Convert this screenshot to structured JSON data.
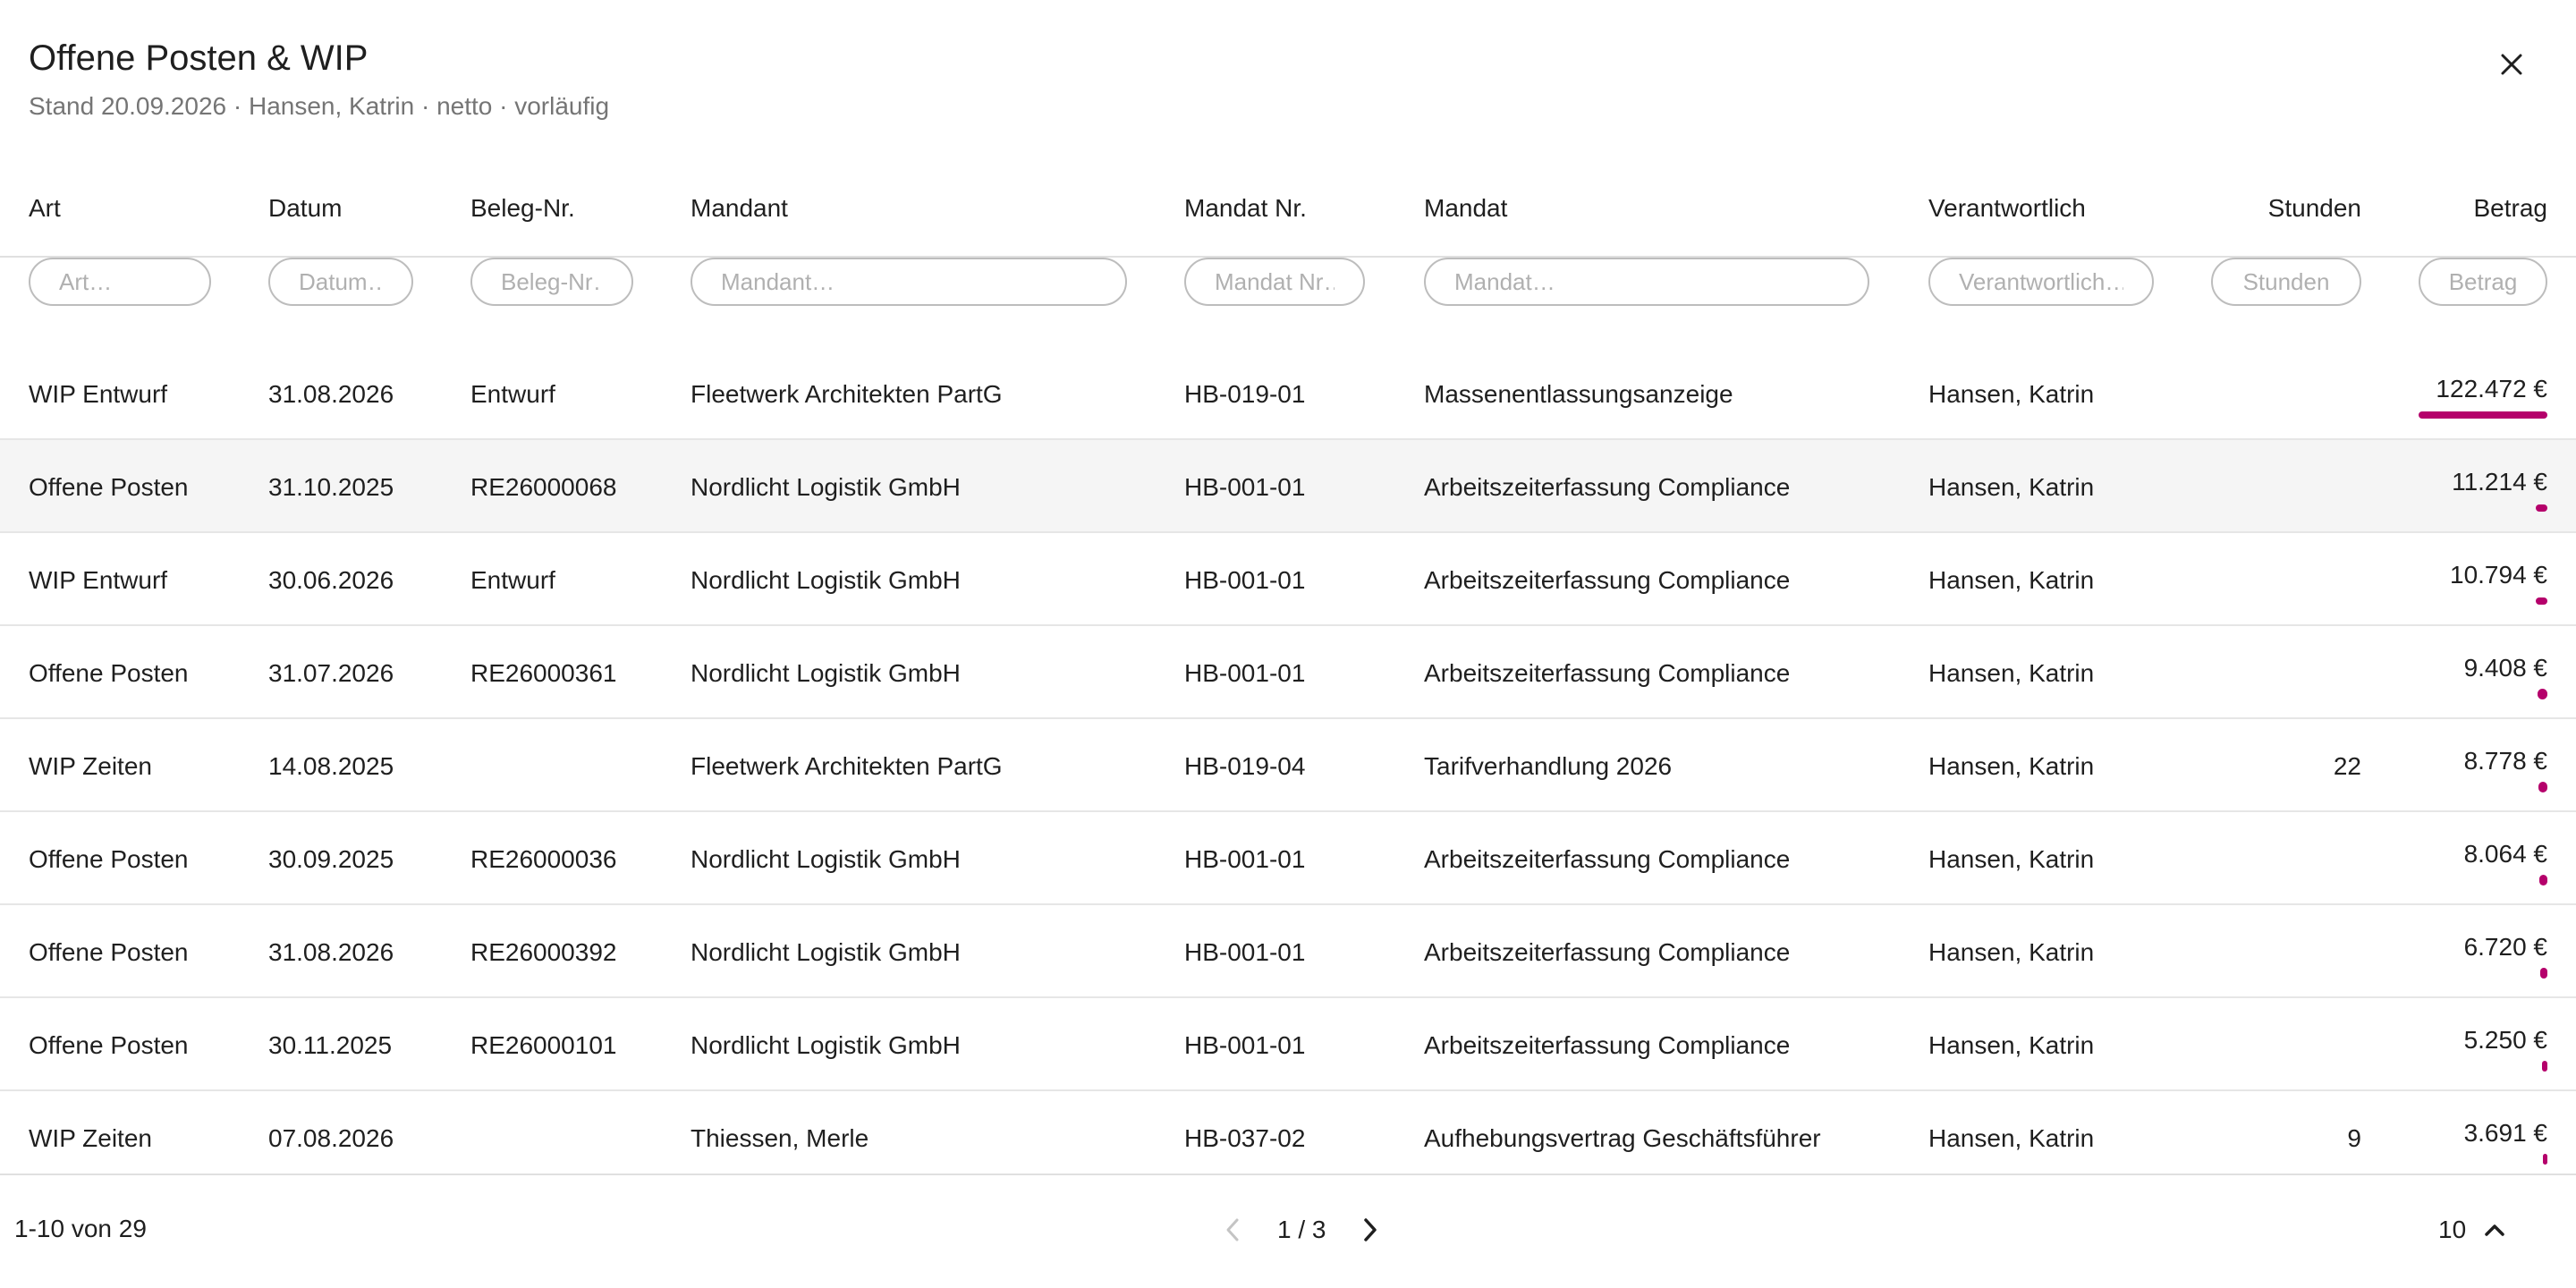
{
  "header": {
    "title": "Offene Posten & WIP",
    "subtitle": "Stand 20.09.2026 · Hansen, Katrin · netto · vorläufig"
  },
  "columns": {
    "art": "Art",
    "datum": "Datum",
    "beleg": "Beleg-Nr.",
    "mandant": "Mandant",
    "mandat_nr": "Mandat Nr.",
    "mandat": "Mandat",
    "verantwortlich": "Verantwortlich",
    "stunden": "Stunden",
    "betrag": "Betrag"
  },
  "filters": {
    "art": "Art…",
    "datum": "Datum…",
    "beleg": "Beleg-Nr…",
    "mandant": "Mandant…",
    "mandat_nr": "Mandat Nr…",
    "mandat": "Mandat…",
    "verantwortlich": "Verantwortlich…",
    "stunden": "Stunden",
    "betrag": "Betrag"
  },
  "accent_color": "#b5006b",
  "max_amount": 122472,
  "rows": [
    {
      "art": "WIP Entwurf",
      "datum": "31.08.2026",
      "beleg": "Entwurf",
      "mandant": "Fleetwerk Architekten PartG",
      "mandat_nr": "HB-019-01",
      "mandat": "Massenentlassungsanzeige",
      "verantwortlich": "Hansen, Katrin",
      "stunden": "",
      "betrag": "122.472 €",
      "amount": 122472
    },
    {
      "art": "Offene Posten",
      "datum": "31.10.2025",
      "beleg": "RE26000068",
      "mandant": "Nordlicht Logistik GmbH",
      "mandat_nr": "HB-001-01",
      "mandat": "Arbeitszeiterfassung Compliance",
      "verantwortlich": "Hansen, Katrin",
      "stunden": "",
      "betrag": "11.214 €",
      "amount": 11214
    },
    {
      "art": "WIP Entwurf",
      "datum": "30.06.2026",
      "beleg": "Entwurf",
      "mandant": "Nordlicht Logistik GmbH",
      "mandat_nr": "HB-001-01",
      "mandat": "Arbeitszeiterfassung Compliance",
      "verantwortlich": "Hansen, Katrin",
      "stunden": "",
      "betrag": "10.794 €",
      "amount": 10794
    },
    {
      "art": "Offene Posten",
      "datum": "31.07.2026",
      "beleg": "RE26000361",
      "mandant": "Nordlicht Logistik GmbH",
      "mandat_nr": "HB-001-01",
      "mandat": "Arbeitszeiterfassung Compliance",
      "verantwortlich": "Hansen, Katrin",
      "stunden": "",
      "betrag": "9.408 €",
      "amount": 9408
    },
    {
      "art": "WIP Zeiten",
      "datum": "14.08.2025",
      "beleg": "",
      "mandant": "Fleetwerk Architekten PartG",
      "mandat_nr": "HB-019-04",
      "mandat": "Tarifverhandlung 2026",
      "verantwortlich": "Hansen, Katrin",
      "stunden": "22",
      "betrag": "8.778 €",
      "amount": 8778
    },
    {
      "art": "Offene Posten",
      "datum": "30.09.2025",
      "beleg": "RE26000036",
      "mandant": "Nordlicht Logistik GmbH",
      "mandat_nr": "HB-001-01",
      "mandat": "Arbeitszeiterfassung Compliance",
      "verantwortlich": "Hansen, Katrin",
      "stunden": "",
      "betrag": "8.064 €",
      "amount": 8064
    },
    {
      "art": "Offene Posten",
      "datum": "31.08.2026",
      "beleg": "RE26000392",
      "mandant": "Nordlicht Logistik GmbH",
      "mandat_nr": "HB-001-01",
      "mandat": "Arbeitszeiterfassung Compliance",
      "verantwortlich": "Hansen, Katrin",
      "stunden": "",
      "betrag": "6.720 €",
      "amount": 6720
    },
    {
      "art": "Offene Posten",
      "datum": "30.11.2025",
      "beleg": "RE26000101",
      "mandant": "Nordlicht Logistik GmbH",
      "mandat_nr": "HB-001-01",
      "mandat": "Arbeitszeiterfassung Compliance",
      "verantwortlich": "Hansen, Katrin",
      "stunden": "",
      "betrag": "5.250 €",
      "amount": 5250
    },
    {
      "art": "WIP Zeiten",
      "datum": "07.08.2026",
      "beleg": "",
      "mandant": "Thiessen, Merle",
      "mandat_nr": "HB-037-02",
      "mandat": "Aufhebungsvertrag Geschäftsführer",
      "verantwortlich": "Hansen, Katrin",
      "stunden": "9",
      "betrag": "3.691 €",
      "amount": 3691
    }
  ],
  "footer": {
    "range": "1-10 von 29",
    "page": "1 / 3",
    "page_size": "10"
  }
}
